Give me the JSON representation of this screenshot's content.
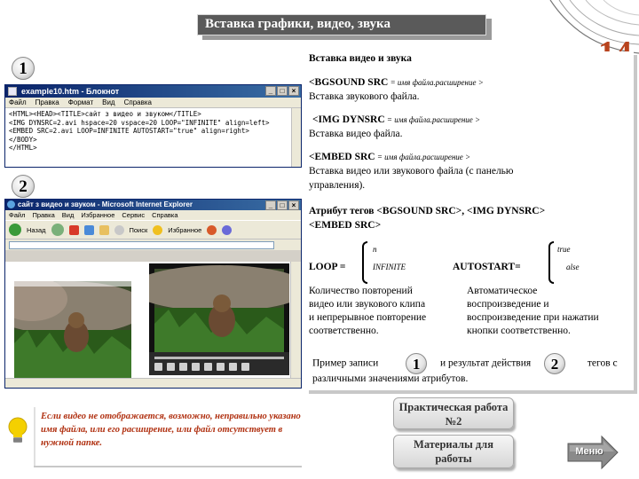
{
  "header": {
    "title": "Вставка графики, видео, звука",
    "page_number": "14"
  },
  "markers": {
    "one": "1",
    "two": "2"
  },
  "notepad": {
    "title": "example10.htm - Блокнот",
    "menu": [
      "Файл",
      "Правка",
      "Формат",
      "Вид",
      "Справка"
    ],
    "lines": [
      "<HTML><HEAD><TITLE>сайт з видео и звуком</TITLE>",
      "<IMG DYNSRC=2.avi hspace=20 vspace=20 LOOP=\"INFINITE\" align=left>",
      "<EMBED SRC=2.avi   LOOP=INFINITE AUTOSTART=\"true\" align=right>",
      "</BODY>",
      "</HTML>"
    ],
    "window_buttons": [
      "_",
      "□",
      "×"
    ]
  },
  "browser": {
    "title": "сайт з видео и звуком - Microsoft Internet Explorer",
    "menu": [
      "Файл",
      "Правка",
      "Вид",
      "Избранное",
      "Сервис",
      "Справка"
    ],
    "back_label": "Назад",
    "search_label": "Поиск",
    "favorites_label": "Избранное",
    "window_buttons": [
      "_",
      "□",
      "×"
    ]
  },
  "panel": {
    "heading": "Вставка видео и звука",
    "bgsound_tag": "<BGSOUND SRC",
    "bgsound_val": " = имя файла.расширение >",
    "bgsound_desc": "Вставка звукового файла.",
    "img_tag": "<IMG DYNSRC",
    "img_val": " = имя файла.расширение >",
    "img_desc": "Вставка видео файла.",
    "embed_tag": "<EMBED SRC",
    "embed_val": " = имя файла.расширение >",
    "embed_desc_1": "Вставка видео или звукового файла (с панелью",
    "embed_desc_2": "управления).",
    "attrs_line_1": "Атрибут тегов <BGSOUND SRC>, <IMG DYNSRC>",
    "attrs_line_2": "<EMBED SRC>",
    "loop_label": "LOOP =",
    "loop_opt_1": "n",
    "loop_opt_2": "INFINITE",
    "autostart_label": "AUTOSTART=",
    "auto_opt_1": "true",
    "auto_opt_2": "alse",
    "loop_desc": [
      "Количество повторений",
      "видео или звукового клипа",
      "и непрерывное повторение",
      "соответственно."
    ],
    "auto_desc": [
      "Автоматическое",
      "воспроизведение и",
      "воспроизведение при нажатии",
      "кнопки соответственно."
    ],
    "example_a": "Пример записи",
    "example_b": "и результат действия",
    "example_c": "тегов с",
    "example_d": "различными значениями атрибутов."
  },
  "tip": {
    "text": "Если видео не отображается, возможно, неправильно указано имя файла, или его расширение, или файл отсутствует в нужной папке."
  },
  "buttons": {
    "practice": "Практическая работа №2",
    "materials": "Материалы для работы",
    "menu": "Меню"
  },
  "colors": {
    "accent": "#b8431d",
    "tip_text": "#b03010",
    "title_bg": "#5a5a5a"
  }
}
